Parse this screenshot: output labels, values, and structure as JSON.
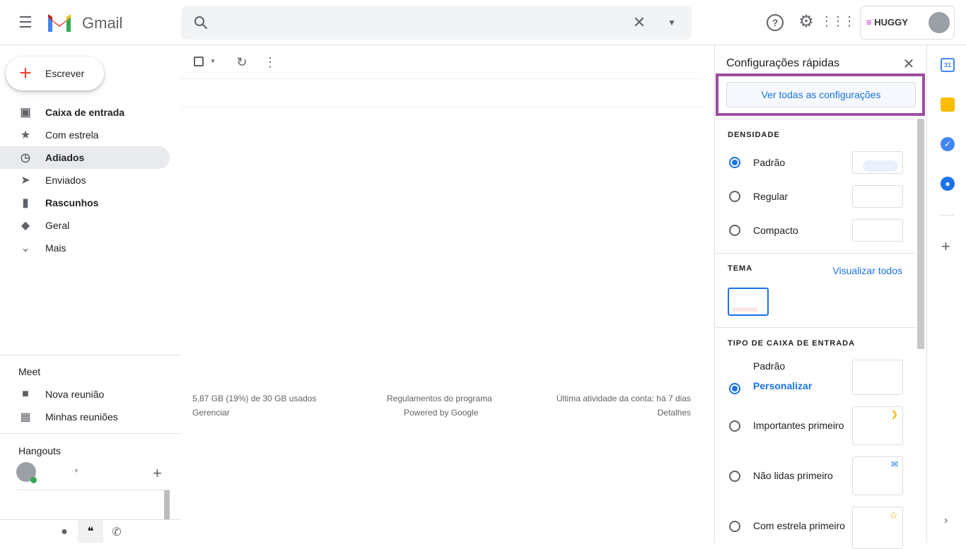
{
  "header": {
    "app_name": "Gmail",
    "search_placeholder": "",
    "brand": "HUGGY"
  },
  "compose": "Escrever",
  "nav": [
    {
      "label": "Caixa de entrada",
      "icon": "inbox-icon",
      "bold": true
    },
    {
      "label": "Com estrela",
      "icon": "star-icon"
    },
    {
      "label": "Adiados",
      "icon": "clock-icon",
      "active": true
    },
    {
      "label": "Enviados",
      "icon": "send-icon"
    },
    {
      "label": "Rascunhos",
      "icon": "draft-icon",
      "bold": true
    },
    {
      "label": "Geral",
      "icon": "label-icon"
    },
    {
      "label": "Mais",
      "icon": "chevron-down-icon"
    }
  ],
  "meet": {
    "title": "Meet",
    "items": [
      "Nova reunião",
      "Minhas reuniões"
    ]
  },
  "hangouts": {
    "title": "Hangouts"
  },
  "footer": {
    "storage": "5,87 GB (19%) de 30 GB usados",
    "manage": "Gerenciar",
    "policies": "Regulamentos do programa",
    "powered": "Powered by Google",
    "activity": "Última atividade da conta: há 7 dias",
    "details": "Detalhes"
  },
  "quick": {
    "title": "Configurações rápidas",
    "see_all": "Ver todas as configurações",
    "density": {
      "title": "DENSIDADE",
      "options": [
        "Padrão",
        "Regular",
        "Compacto"
      ],
      "selected": 0
    },
    "theme": {
      "title": "TEMA",
      "view_all": "Visualizar todos"
    },
    "inbox": {
      "title": "TIPO DE CAIXA DE ENTRADA",
      "options": [
        "Padrão",
        "Importantes primeiro",
        "Não lidas primeiro",
        "Com estrela primeiro"
      ],
      "customize": "Personalizar",
      "selected": 0
    }
  },
  "colors": {
    "accent": "#1a73e8",
    "highlight": "#9b4ea0"
  }
}
